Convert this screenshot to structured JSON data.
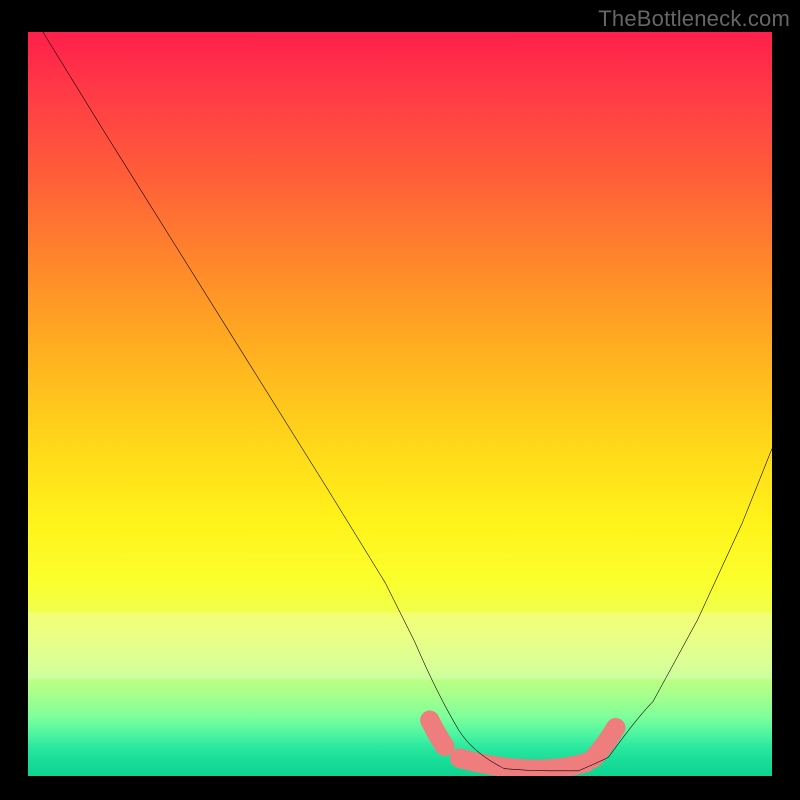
{
  "watermark": "TheBottleneck.com",
  "chart_data": {
    "type": "line",
    "title": "",
    "xlabel": "",
    "ylabel": "",
    "xlim": [
      0,
      100
    ],
    "ylim": [
      0,
      100
    ],
    "series": [
      {
        "name": "curve",
        "x": [
          2,
          10,
          20,
          30,
          40,
          48,
          52,
          55,
          58,
          60,
          64,
          70,
          74,
          78,
          84,
          90,
          96,
          100
        ],
        "y": [
          100,
          87,
          71,
          55,
          39,
          26,
          18,
          11,
          6,
          3,
          1,
          0.7,
          0.7,
          2.5,
          10,
          21,
          34,
          44
        ]
      }
    ],
    "highlight_band_x": [
      55,
      78
    ],
    "highlight_color": "#f07a7a",
    "curve_color": "#000000",
    "gradient_stops": [
      {
        "pos": 0,
        "color": "#ff1f4b"
      },
      {
        "pos": 20,
        "color": "#ff6038"
      },
      {
        "pos": 44,
        "color": "#ffb31f"
      },
      {
        "pos": 66,
        "color": "#fff31a"
      },
      {
        "pos": 85,
        "color": "#d0ff7a"
      },
      {
        "pos": 100,
        "color": "#0fd492"
      }
    ]
  }
}
